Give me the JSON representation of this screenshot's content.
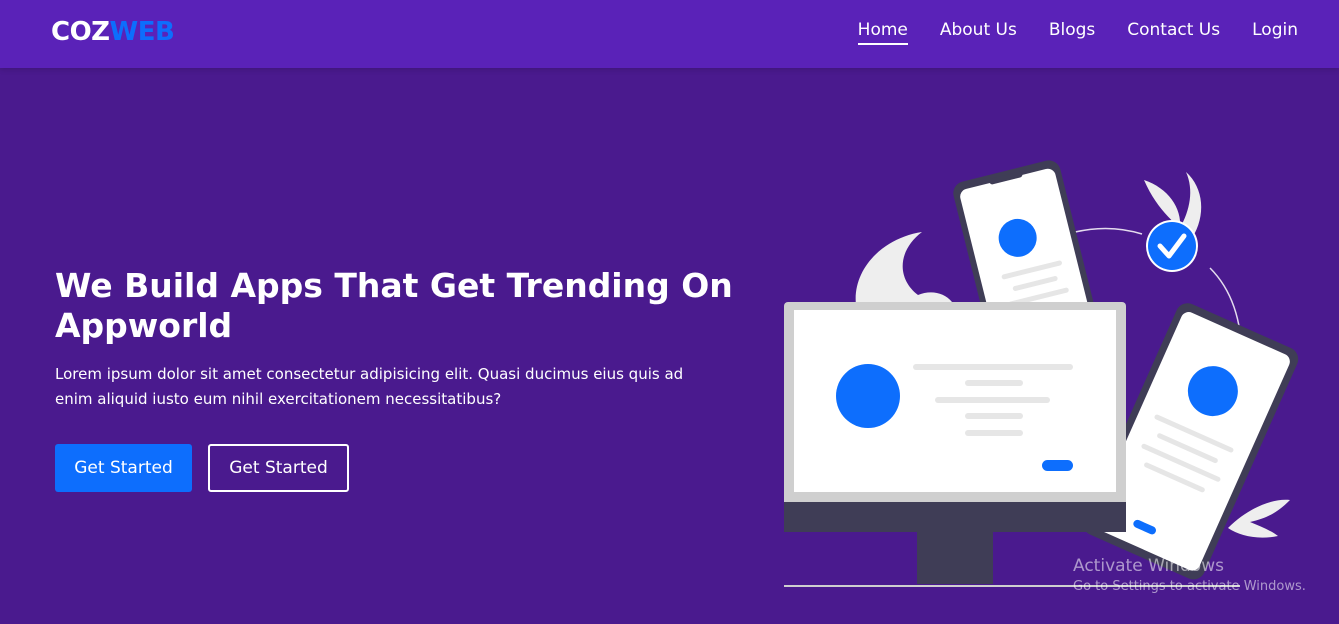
{
  "brand": {
    "part1": "COZ",
    "part2": "WEB"
  },
  "nav": {
    "home": "Home",
    "about": "About Us",
    "blogs": "Blogs",
    "contact": "Contact Us",
    "login": "Login"
  },
  "hero": {
    "title": "We Build Apps That Get Trending On Appworld",
    "text": "Lorem ipsum dolor sit amet consectetur adipisicing elit. Quasi ducimus eius quis ad enim aliquid iusto eum nihil exercitationem necessitatibus?",
    "primary_button": "Get Started",
    "secondary_button": "Get Started"
  },
  "watermark": {
    "title": "Activate Windows",
    "subtitle": "Go to Settings to activate Windows."
  },
  "colors": {
    "background": "#4a1a8e",
    "navbar": "#5a22b8",
    "accent": "#0d6efd"
  }
}
